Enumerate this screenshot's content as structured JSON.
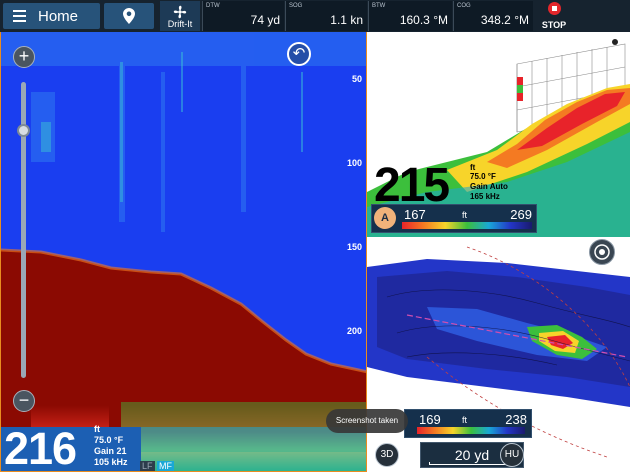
{
  "topbar": {
    "home_label": "Home",
    "drift_label": "Drift-It",
    "fields": [
      {
        "label": "DTW",
        "value": "74 yd"
      },
      {
        "label": "SOG",
        "value": "1.1 kn"
      },
      {
        "label": "BTW",
        "value": "160.3 °M"
      },
      {
        "label": "COG",
        "value": "348.2 °M"
      }
    ],
    "stop_label": "STOP"
  },
  "sonar": {
    "depth_scale": [
      "50",
      "100",
      "150",
      "200"
    ],
    "depth_value": "216",
    "depth_unit": "ft",
    "water_temp": "75.0 °F",
    "gain": "Gain 21",
    "frequency": "105 kHz",
    "freq_tags": [
      "LF",
      "MF"
    ],
    "zoom_in": "+",
    "zoom_out": "−"
  },
  "view3d": {
    "depth_value": "215",
    "depth_unit": "ft",
    "water_temp": "75.0 °F",
    "gain": "Gain Auto",
    "frequency": "165 kHz",
    "mode_badge": "A",
    "scale_min": "167",
    "scale_max": "269",
    "scale_unit": "ft"
  },
  "map3d": {
    "scale_min": "169",
    "scale_max": "238",
    "scale_unit": "ft",
    "view_button": "3D",
    "range": "20 yd",
    "heading_button": "HU"
  },
  "toast": "Screenshot taken",
  "colors": {
    "accent_orange": "#e98c1f",
    "sonar_blue": "#1a3ef0",
    "bottom_red": "#8b0a02",
    "stop_red": "#e3262b"
  }
}
